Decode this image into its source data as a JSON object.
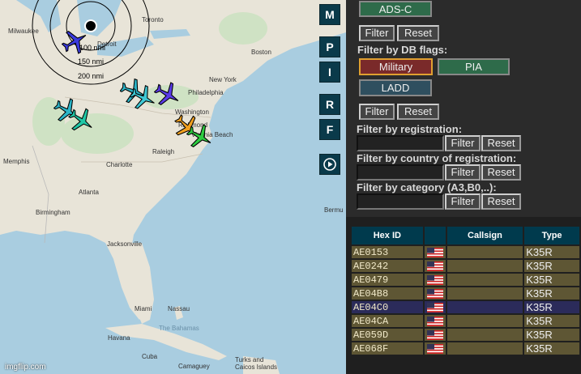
{
  "map": {
    "range_rings": [
      "100 nmi",
      "150 nmi",
      "200 nmi"
    ],
    "cities": [
      "Milwaukee",
      "Detroit",
      "Toronto",
      "Boston",
      "New York",
      "Philadelphia",
      "Washington",
      "Richmond",
      "Virginia Beach",
      "Raleigh",
      "Charlotte",
      "Memphis",
      "Atlanta",
      "Birmingham",
      "Jacksonville",
      "Miami",
      "Nassau",
      "The Bahamas",
      "Havana",
      "Cuba",
      "Camaguey",
      "Turks and Caicos Islands",
      "Bermu"
    ],
    "watermark": "imgflip.com",
    "buttons": {
      "m": "M",
      "p": "P",
      "i": "I",
      "r": "R",
      "f": "F"
    },
    "aircraft_colors": [
      "#3a3adf",
      "#2bb5c8",
      "#1fc8a6",
      "#3ec8d4",
      "#5a3ae8",
      "#f0a020",
      "#2ecc40"
    ]
  },
  "panel": {
    "adsc_label": "ADS-C",
    "filter_label": "Filter",
    "reset_label": "Reset",
    "db_flags_heading": "Filter by DB flags:",
    "military_label": "Military",
    "pia_label": "PIA",
    "ladd_label": "LADD",
    "registration_heading": "Filter by registration:",
    "country_heading": "Filter by country of registration:",
    "category_heading": "Filter by category (A3,B0,..):",
    "registration_value": "",
    "country_value": "",
    "category_value": ""
  },
  "table": {
    "columns": [
      "Hex ID",
      "",
      "Callsign",
      "Type"
    ],
    "rows": [
      {
        "hex": "AE0153",
        "callsign": "",
        "type": "K35R"
      },
      {
        "hex": "AE0242",
        "callsign": "",
        "type": "K35R"
      },
      {
        "hex": "AE0479",
        "callsign": "",
        "type": "K35R"
      },
      {
        "hex": "AE04B8",
        "callsign": "",
        "type": "K35R"
      },
      {
        "hex": "AE04C0",
        "callsign": "",
        "type": "K35R",
        "selected": true
      },
      {
        "hex": "AE04CA",
        "callsign": "",
        "type": "K35R"
      },
      {
        "hex": "AE059D",
        "callsign": "",
        "type": "K35R"
      },
      {
        "hex": "AE068F",
        "callsign": "",
        "type": "K35R"
      }
    ]
  }
}
